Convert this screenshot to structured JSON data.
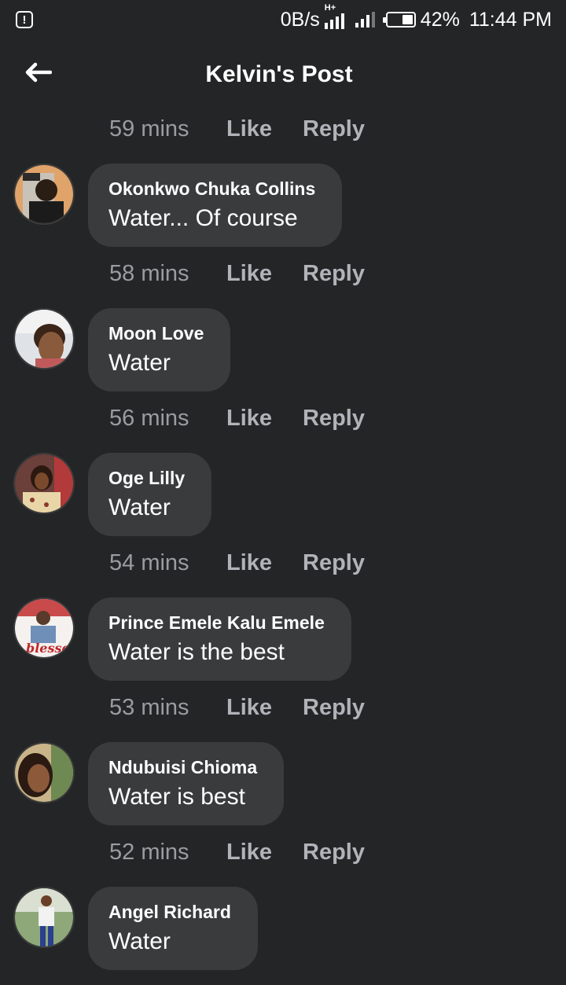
{
  "status_bar": {
    "alert_icon": "!",
    "speed": "0B/s",
    "network": "H+",
    "battery": "42%",
    "battery_fraction": 0.42,
    "time": "11:44 PM"
  },
  "header": {
    "title": "Kelvin's Post",
    "back_icon": "arrow-left-icon"
  },
  "actions": {
    "like": "Like",
    "reply": "Reply"
  },
  "top_meta": {
    "time": "59 mins"
  },
  "comments": [
    {
      "author": "Okonkwo Chuka Collins",
      "text": "Water... Of course",
      "time": "58 mins"
    },
    {
      "author": "Moon Love",
      "text": "Water",
      "time": "56 mins"
    },
    {
      "author": "Oge Lilly",
      "text": "Water",
      "time": "54 mins"
    },
    {
      "author": "Prince Emele Kalu Emele",
      "text": "Water is the best",
      "time": "53 mins"
    },
    {
      "author": "Ndubuisi Chioma",
      "text": "Water is best",
      "time": "52 mins"
    },
    {
      "author": "Angel Richard",
      "text": "Water",
      "time": ""
    }
  ],
  "colors": {
    "background": "#242526",
    "bubble": "#3a3b3c",
    "meta_time": "#9a9ca1",
    "meta_action": "#b0b3b8"
  }
}
